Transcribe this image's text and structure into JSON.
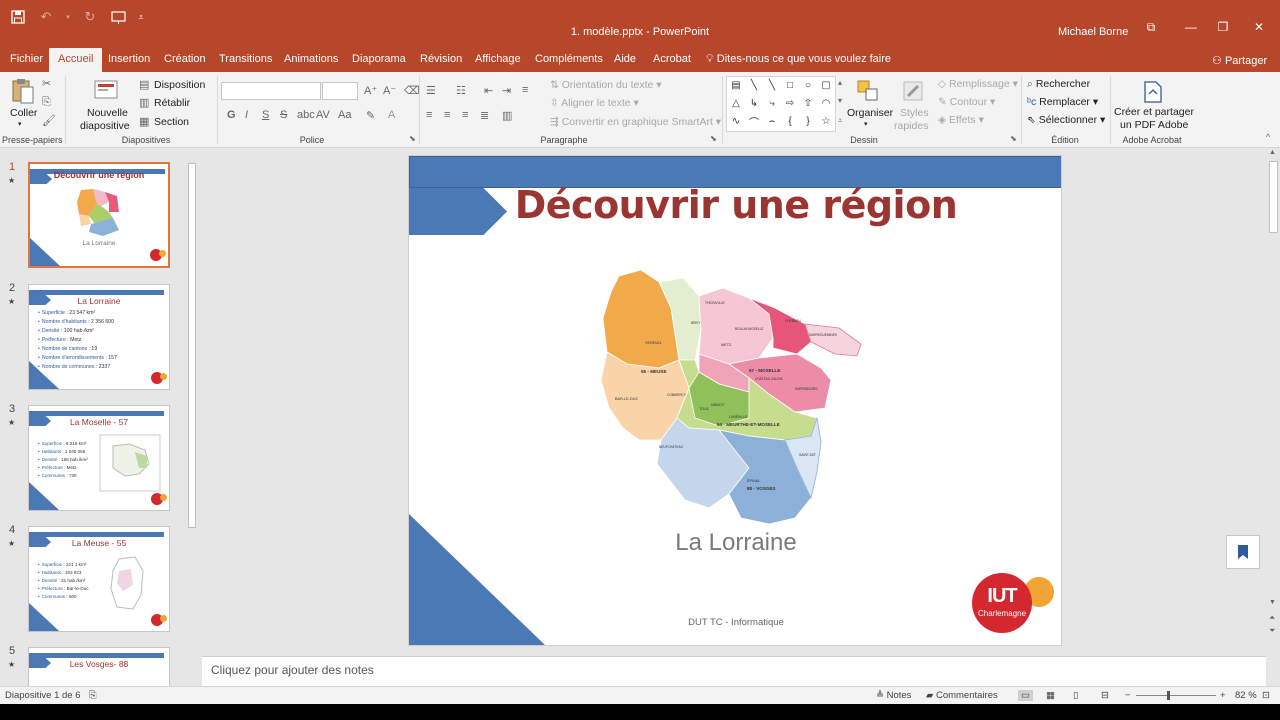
{
  "window": {
    "title": "1. modèle.pptx  -  PowerPoint",
    "user": "Michael Borne",
    "controls": [
      "restore-ribbon",
      "minimize",
      "maximize",
      "close"
    ]
  },
  "tabs": [
    "Fichier",
    "Accueil",
    "Insertion",
    "Création",
    "Transitions",
    "Animations",
    "Diaporama",
    "Révision",
    "Affichage",
    "Compléments",
    "Aide",
    "Acrobat"
  ],
  "active_tab": "Accueil",
  "tell_me": "Dites-nous ce que vous voulez faire",
  "share": "Partager",
  "ribbon": {
    "clipboard": {
      "paste": "Coller",
      "label": "Presse-papiers"
    },
    "slides": {
      "new_slide_1": "Nouvelle",
      "new_slide_2": "diapositive",
      "layout": "Disposition",
      "reset": "Rétablir",
      "section": "Section",
      "label": "Diapositives"
    },
    "font": {
      "label": "Police",
      "bold": "G",
      "italic": "I",
      "underline": "S",
      "strike": "S",
      "spacing": "AV",
      "case": "Aa"
    },
    "paragraph": {
      "text_direction": "Orientation du texte",
      "align_text": "Aligner le texte",
      "smartart": "Convertir en graphique SmartArt",
      "label": "Paragraphe"
    },
    "drawing": {
      "arrange": "Organiser",
      "quick_styles_1": "Styles",
      "quick_styles_2": "rapides",
      "fill": "Remplissage",
      "outline": "Contour",
      "effects": "Effets",
      "label": "Dessin"
    },
    "editing": {
      "find": "Rechercher",
      "replace": "Remplacer",
      "select": "Sélectionner",
      "label": "Édition"
    },
    "acrobat": {
      "create_1": "Créer et partager",
      "create_2": "un PDF Adobe",
      "label": "Adobe Acrobat"
    }
  },
  "thumbnails": [
    {
      "number": "1",
      "title": "Découvrir une région",
      "subtitle": "La Lorraine",
      "active": true
    },
    {
      "number": "2",
      "title": "La Lorraine",
      "bullets": [
        {
          "k": "Superficie",
          "v": " : 23 547 km²"
        },
        {
          "k": "Nombre d'habitants",
          "v": " : 2 356 600"
        },
        {
          "k": "Densité",
          "v": " : 100 hab./km²"
        },
        {
          "k": "Préfecture",
          "v": " : Metz"
        },
        {
          "k": "Nombre de cantons",
          "v": " : 19"
        },
        {
          "k": "Nombre  d'arrondissements",
          "v": " : 157"
        },
        {
          "k": "Nombre  de communes",
          "v": " : 2337"
        }
      ]
    },
    {
      "number": "3",
      "title": "La Moselle - 57",
      "bullets": [
        {
          "k": "Superficie",
          "v": " : 6 216 km²"
        },
        {
          "k": "Habitants",
          "v": " : 1 045 066"
        },
        {
          "k": "Densité",
          "v": " : 168 hab./km²"
        },
        {
          "k": "Préfecture",
          "v": " : Metz"
        },
        {
          "k": "Communes",
          "v": " : 730"
        }
      ]
    },
    {
      "number": "4",
      "title": "La Meuse - 55",
      "bullets": [
        {
          "k": "Superficie",
          "v": " : 221 1 km²"
        },
        {
          "k": "Habitants",
          "v": " : 193 923"
        },
        {
          "k": "Densité",
          "v": " : 31 hab./km²"
        },
        {
          "k": "Préfecture",
          "v": " : Bar-le-Duc"
        },
        {
          "k": "Communes",
          "v": " : 500"
        }
      ]
    },
    {
      "number": "5",
      "title": "Les Vosges- 88"
    }
  ],
  "slide": {
    "title": "Découvrir une région",
    "subtitle": "La Lorraine",
    "footer": "DUT TC - Informatique",
    "logo_text": "IUT",
    "logo_sub": "Charlemagne",
    "map_labels": {
      "meuse": "55 - MEUSE",
      "moselle": "57 - MOSELLE",
      "mm": "54 - MEURTHE-ET-MOSELLE",
      "vosges": "88 - VOSGES",
      "verdun": "VERDUN",
      "bar": "BAR-LE-DUC",
      "metz": "METZ",
      "nancy": "NANCY",
      "epinal": "ÉPINAL",
      "toul": "TOUL",
      "thionville": "THIONVILLE",
      "luneville": "LUNÉVILLE",
      "saint_die": "SAINT-DIÉ",
      "sarreguemines": "SARREGUEMINES",
      "sarrebourg": "SARREBOURG",
      "neufchateau": "NEUFCHÂTEAU",
      "briey": "BRIEY",
      "commercy": "COMMERCY",
      "boulay": "BOULAY-MOSELLE",
      "forbach": "FORBACH",
      "chateau": "CHÂTEAU-SALINS"
    }
  },
  "notes_placeholder": "Cliquez pour ajouter des notes",
  "status": {
    "slide_info": "Diapositive 1 de 6",
    "notes": "Notes",
    "comments": "Commentaires",
    "zoom": "82 %"
  },
  "colors": {
    "accent": "#b7472a",
    "slide_blue": "#4b79b6",
    "title_red": "#9b3532",
    "logo_red": "#d4272e",
    "logo_orange": "#f2a535"
  }
}
